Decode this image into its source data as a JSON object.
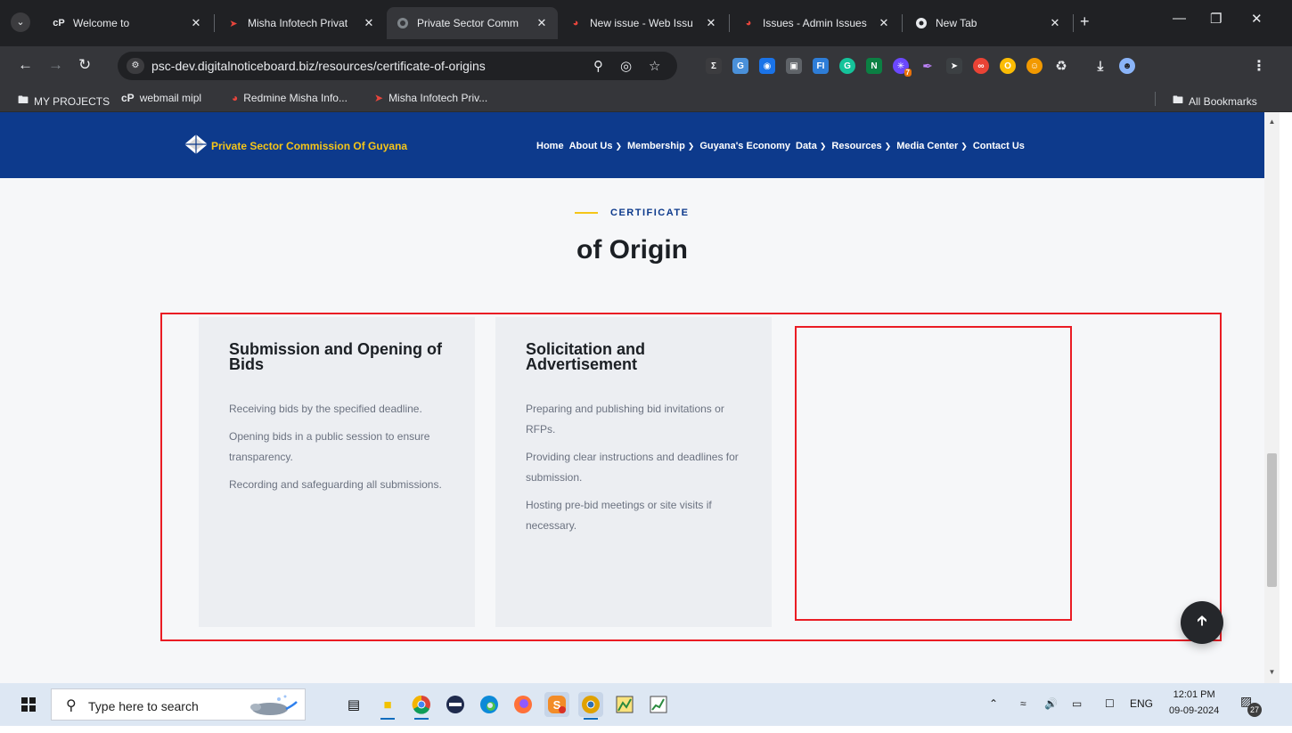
{
  "tabs": [
    {
      "title": "Welcome to",
      "favicon": "cpanel-icon",
      "color": "#e8eaed",
      "active": false,
      "closable": true
    },
    {
      "title": "Misha Infotech Privat",
      "favicon": "misha-icon",
      "color": "#e8453c",
      "active": false,
      "closable": true
    },
    {
      "title": "Private Sector Comm",
      "favicon": "globe-icon",
      "color": "#9aa0a6",
      "active": true,
      "closable": true
    },
    {
      "title": "New issue - Web Issu",
      "favicon": "redmine-icon",
      "color": "#e8453c",
      "active": false,
      "closable": true
    },
    {
      "title": "Issues - Admin Issues",
      "favicon": "redmine-icon",
      "color": "#e8453c",
      "active": false,
      "closable": true
    },
    {
      "title": "New Tab",
      "favicon": "chrome-icon",
      "color": "#e8eaed",
      "active": false,
      "closable": true
    }
  ],
  "address_bar": {
    "url": "psc-dev.digitalnoticeboard.biz/resources/certificate-of-origins"
  },
  "bookmarks": [
    {
      "label": "MY PROJECTS",
      "icon": "folder-icon"
    },
    {
      "label": "webmail mipl",
      "icon": "cpanel-icon"
    },
    {
      "label": "Redmine Misha Info...",
      "icon": "redmine-icon"
    },
    {
      "label": "Misha Infotech Priv...",
      "icon": "misha-icon"
    }
  ],
  "all_bookmarks": "All Bookmarks",
  "site": {
    "logo_text": "Private Sector Commission Of Guyana",
    "brand_color": "#0d3a8c",
    "accent_color": "#f5c518",
    "nav": [
      {
        "label": "Home",
        "dropdown": false
      },
      {
        "label": "About Us",
        "dropdown": true
      },
      {
        "label": "Membership",
        "dropdown": true
      },
      {
        "label": "Guyana's Economy",
        "dropdown": false
      },
      {
        "label": "Data",
        "dropdown": true
      },
      {
        "label": "Resources",
        "dropdown": true
      },
      {
        "label": "Media Center",
        "dropdown": true
      },
      {
        "label": "Contact Us",
        "dropdown": false
      }
    ]
  },
  "section": {
    "eyebrow": "CERTIFICATE",
    "title": "of Origin"
  },
  "cards": [
    {
      "title": "Submission and Opening of Bids",
      "items": [
        "Receiving bids by the specified deadline.",
        "Opening bids in a public session to ensure transparency.",
        "Recording and safeguarding all submissions."
      ]
    },
    {
      "title": "Solicitation and Advertisement",
      "items": [
        "Preparing and publishing bid invitations or RFPs.",
        "Providing clear instructions and deadlines for submission.",
        "Hosting pre-bid meetings or site visits if necessary."
      ]
    }
  ],
  "annotation_color": "#ea1c24",
  "taskbar": {
    "search_placeholder": "Type here to search",
    "language": "ENG",
    "time": "12:01 PM",
    "date": "09-09-2024",
    "notification_count": "27"
  },
  "extension_badge": "7"
}
